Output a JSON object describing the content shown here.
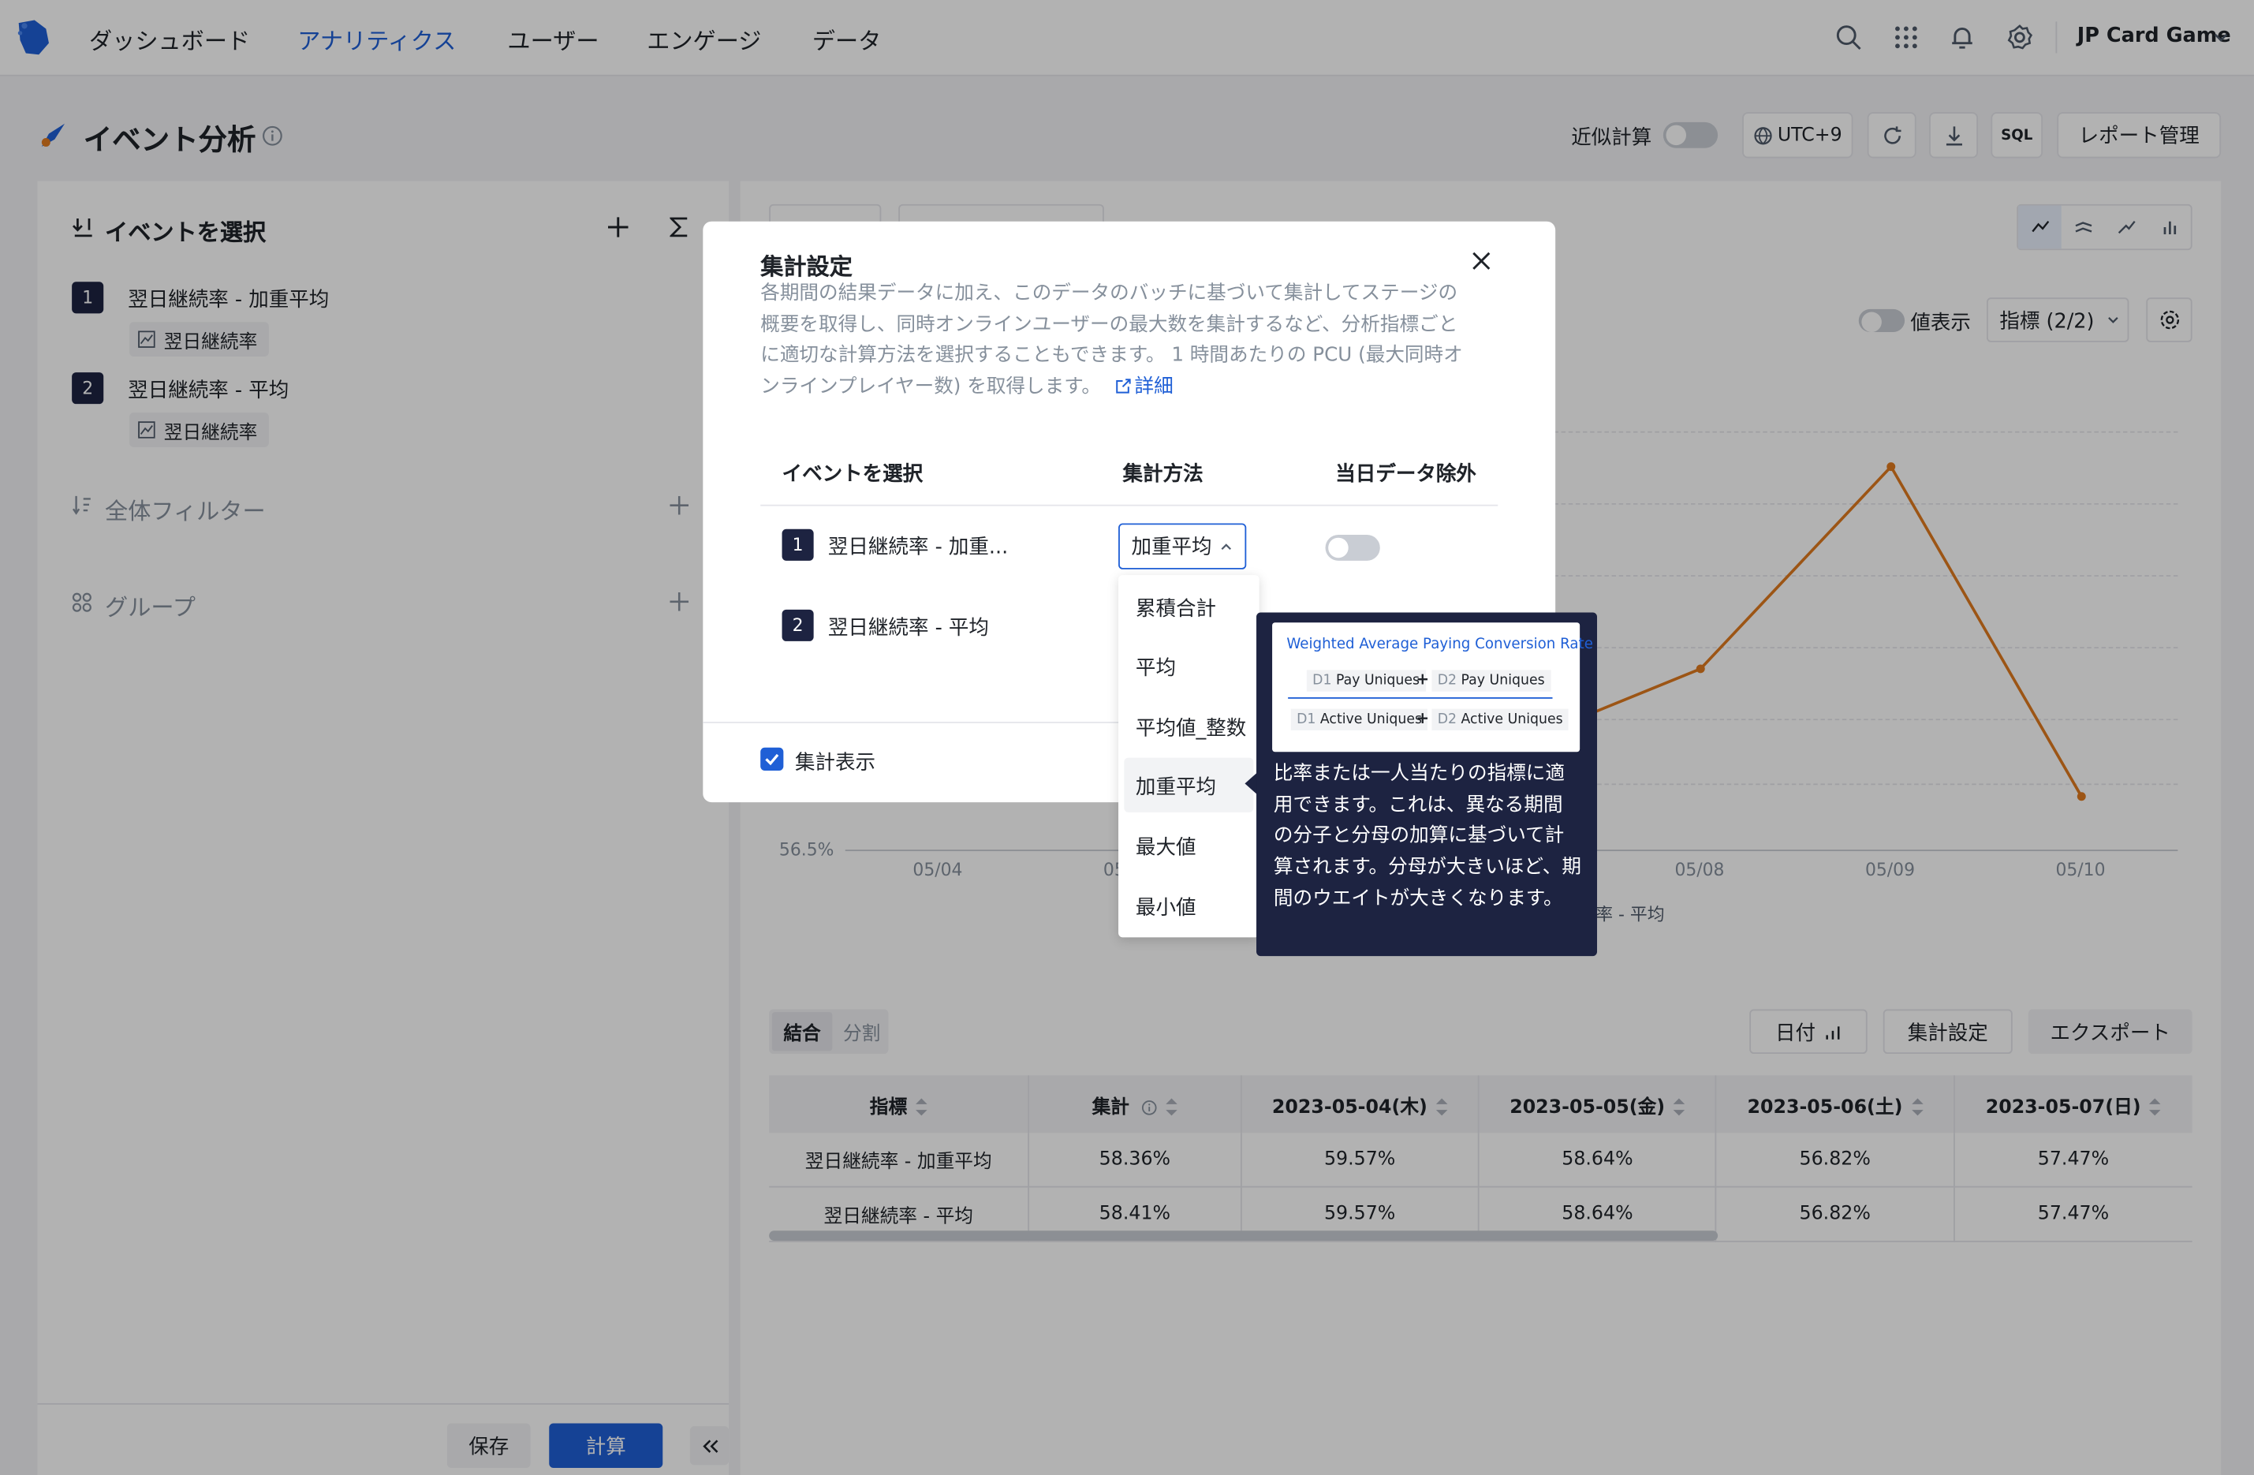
{
  "nav": {
    "items": [
      "ダッシュボード",
      "アナリティクス",
      "ユーザー",
      "エンゲージ",
      "データ"
    ],
    "active_index": 1,
    "app_name": "JP Card Game"
  },
  "header": {
    "title": "イベント分析",
    "approx_label": "近似計算",
    "timezone": "UTC+9",
    "sql_label": "SQL",
    "report_label": "レポート管理"
  },
  "left": {
    "select_event_title": "イベントを選択",
    "events": [
      {
        "num": "1",
        "name": "翌日継続率 - 加重平均",
        "metric": "翌日継続率"
      },
      {
        "num": "2",
        "name": "翌日継続率 - 平均",
        "metric": "翌日継続率"
      }
    ],
    "filter_title": "全体フィルター",
    "group_title": "グループ",
    "save_label": "保存",
    "calc_label": "計算"
  },
  "chart": {
    "value_display_label": "値表示",
    "metric_select": "指標 (2/2)",
    "y_min_label": "56.5%",
    "legend_partial": "率 - 平均"
  },
  "chart_data": {
    "type": "line",
    "categories": [
      "05/04",
      "05/05",
      "05/06",
      "05/07",
      "05/08",
      "05/09",
      "05/10"
    ],
    "series": [
      {
        "name": "翌日継続率 - 平均",
        "values": [
          59.57,
          58.64,
          56.82,
          57.47,
          58.2,
          60.1,
          57.0
        ]
      }
    ],
    "ylim": [
      56.5,
      60.5
    ],
    "grid": true
  },
  "table": {
    "tab_combined": "結合",
    "tab_split": "分割",
    "date_btn": "日付",
    "agg_btn": "集計設定",
    "export_btn": "エクスポート",
    "columns": [
      "指標",
      "集計",
      "2023-05-04(木)",
      "2023-05-05(金)",
      "2023-05-06(土)",
      "2023-05-07(日)"
    ],
    "rows": [
      [
        "翌日継続率 - 加重平均",
        "58.36%",
        "59.57%",
        "58.64%",
        "56.82%",
        "57.47%"
      ],
      [
        "翌日継続率 - 平均",
        "58.41%",
        "59.57%",
        "58.64%",
        "56.82%",
        "57.47%"
      ]
    ]
  },
  "modal": {
    "title": "集計設定",
    "description": "各期間の結果データに加え、このデータのバッチに基づいて集計してステージの概要を取得し、同時オンラインユーザーの最大数を集計するなど、分析指標ごとに適切な計算方法を選択することもできます。 1 時間あたりの PCU (最大同時オンラインプレイヤー数) を取得します。",
    "detail_link": "詳細",
    "col_event": "イベントを選択",
    "col_method": "集計方法",
    "col_exclude": "当日データ除外",
    "rows": [
      {
        "num": "1",
        "name": "翌日継続率 - 加重...",
        "method": "加重平均"
      },
      {
        "num": "2",
        "name": "翌日継続率 - 平均"
      }
    ],
    "show_total_label": "集計表示"
  },
  "dropdown": {
    "options": [
      "累積合計",
      "平均",
      "平均値_整数",
      "加重平均",
      "最大値",
      "最小値"
    ],
    "highlighted_index": 3
  },
  "tooltip": {
    "formula_title": "Weighted Average Paying Conversion Rate",
    "numerator": [
      {
        "d": "D1",
        "label": "Pay Uniques"
      },
      {
        "d": "D2",
        "label": "Pay Uniques"
      }
    ],
    "denominator": [
      {
        "d": "D1",
        "label": "Active Uniques"
      },
      {
        "d": "D2",
        "label": "Active Uniques"
      }
    ],
    "plus": "+",
    "text": "比率または一人当たりの指標に適用できます。これは、異なる期間の分子と分母の加算に基づいて計算されます。分母が大きいほど、期間のウエイトが大きくなります。"
  },
  "colors": {
    "accent": "#1f5fd6",
    "navy": "#1d2341",
    "line": "#e07a1f"
  }
}
